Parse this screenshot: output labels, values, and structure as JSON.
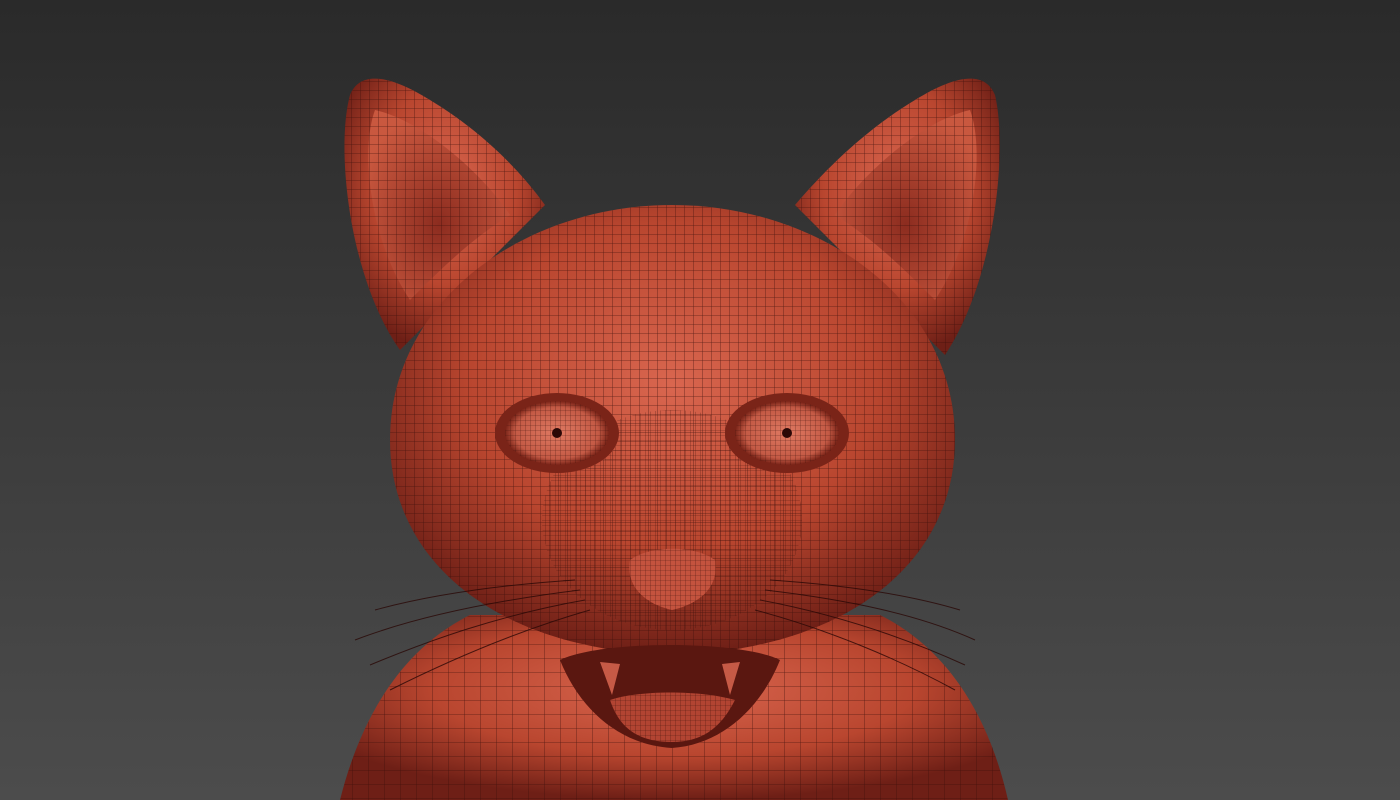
{
  "scene": {
    "subject": "cat-head-wireframe-sculpt",
    "colors": {
      "background_top": "#2a2a2a",
      "background_bottom": "#4c4c4c",
      "skin_light": "#d2604c",
      "skin_mid": "#b5432f",
      "skin_dark": "#6e1f16",
      "wire": "#3a0e0a"
    }
  }
}
